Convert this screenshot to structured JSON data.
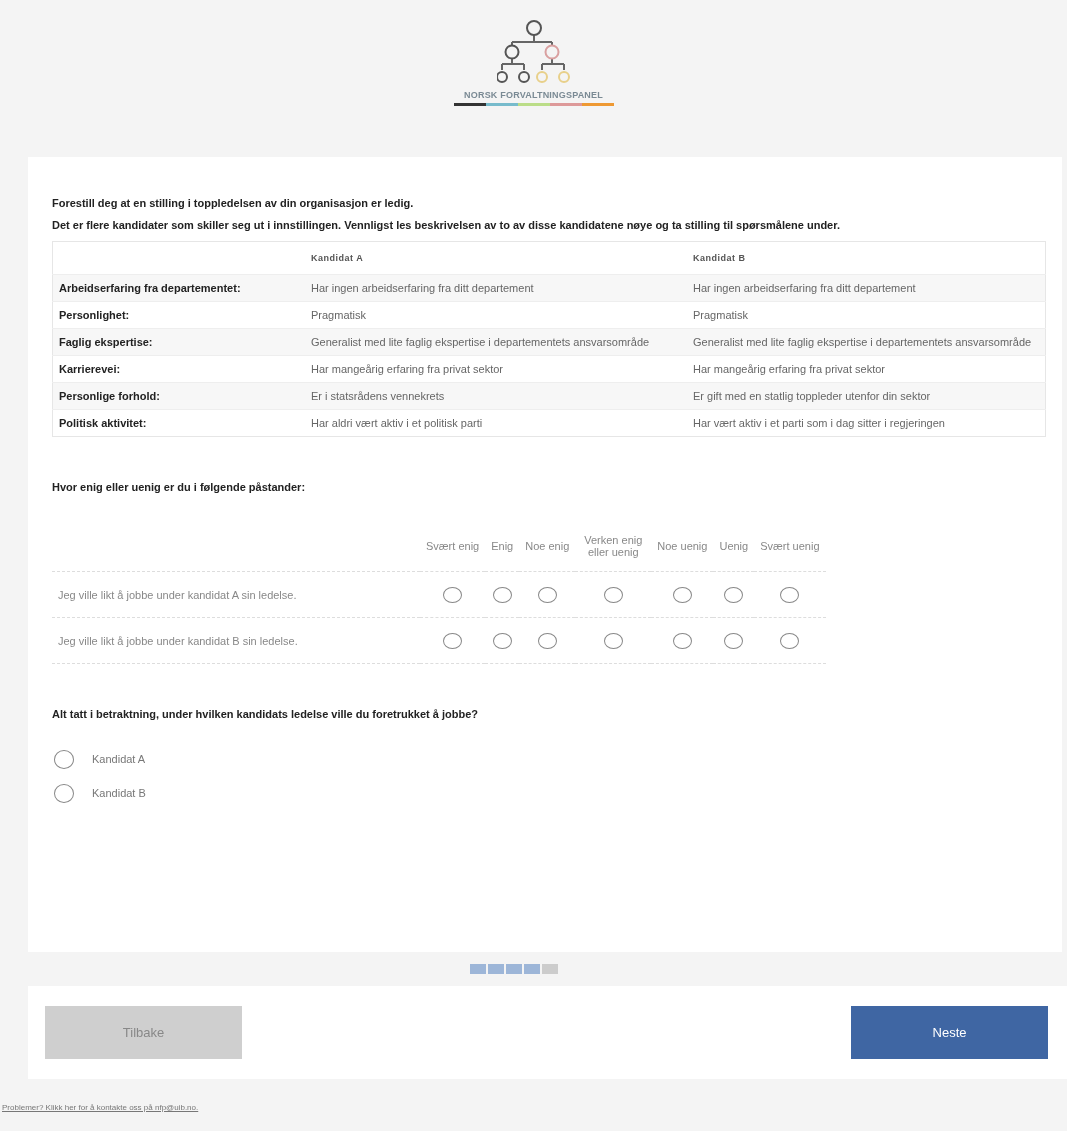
{
  "logo": {
    "title": "NORSK FORVALTNINGSPANEL"
  },
  "intro": [
    "Forestill deg at en stilling i toppledelsen av din organisasjon er ledig.",
    "Det er flere kandidater som skiller seg ut i innstillingen. Vennligst les beskrivelsen av to av disse kandidatene nøye og ta stilling til spørsmålene under."
  ],
  "table": {
    "columns": [
      "Kandidat A",
      "Kandidat B"
    ],
    "rows": [
      {
        "label": "Arbeidserfaring fra departementet:",
        "a": "Har ingen arbeidserfaring fra ditt departement",
        "b": "Har ingen arbeidserfaring fra ditt departement"
      },
      {
        "label": "Personlighet:",
        "a": "Pragmatisk",
        "b": "Pragmatisk"
      },
      {
        "label": "Faglig ekspertise:",
        "a": "Generalist med lite faglig ekspertise i departementets ansvarsområde",
        "b": "Generalist med lite faglig ekspertise i departementets ansvarsområde"
      },
      {
        "label": "Karrierevei:",
        "a": "Har mangeårig erfaring fra privat sektor",
        "b": "Har mangeårig erfaring fra privat sektor"
      },
      {
        "label": "Personlige forhold:",
        "a": "Er i statsrådens vennekrets",
        "b": "Er gift med en statlig toppleder utenfor din sektor"
      },
      {
        "label": "Politisk aktivitet:",
        "a": "Har aldri vært aktiv i et politisk parti",
        "b": "Har vært aktiv i et parti som i dag sitter i regjeringen"
      }
    ]
  },
  "matrix": {
    "question": "Hvor enig eller uenig er du i følgende påstander:",
    "scale": [
      "Svært enig",
      "Enig",
      "Noe enig",
      "Verken enig eller uenig",
      "Noe uenig",
      "Uenig",
      "Svært uenig"
    ],
    "rows": [
      {
        "statement": "Jeg ville likt å jobbe under kandidat A sin ledelse.",
        "selected": [
          false,
          false,
          false,
          false,
          false,
          false,
          false
        ]
      },
      {
        "statement": "Jeg ville likt å jobbe under kandidat B sin ledelse.",
        "selected": [
          false,
          false,
          false,
          false,
          false,
          false,
          false
        ]
      }
    ]
  },
  "choice": {
    "question": "Alt tatt i betraktning, under hvilken kandidats ledelse ville du foretrukket å jobbe?",
    "options": [
      {
        "label": "Kandidat A",
        "selected": false
      },
      {
        "label": "Kandidat B",
        "selected": false
      }
    ]
  },
  "progress": {
    "level": 0.8
  },
  "buttons": [
    {
      "label": "Tilbake",
      "disabled": true
    },
    {
      "label": "Neste",
      "disabled": false
    }
  ],
  "footer_link": "Problemer? Klikk her for å kontakte oss på nfp@uib.no."
}
